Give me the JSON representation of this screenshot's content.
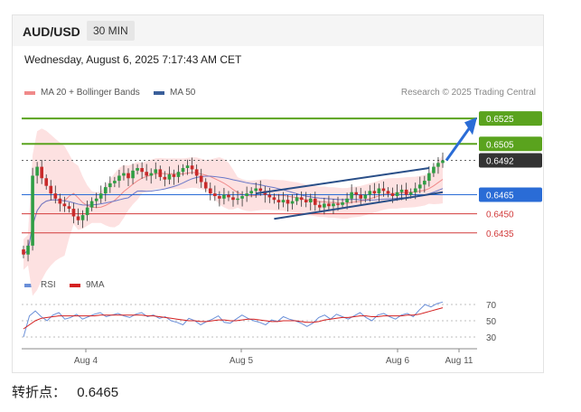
{
  "header": {
    "pair": "AUD/USD",
    "timeframe": "30 MIN"
  },
  "date": "Wednesday, August 6, 2025 7:17:43 AM CET",
  "legend": [
    {
      "label": "MA 20 + Bollinger Bands",
      "color": "#f08a8a"
    },
    {
      "label": "MA 50",
      "color": "#3a5f9a"
    }
  ],
  "credit": "Research © 2025 Trading Central",
  "rsi_legend": [
    {
      "label": "RSI",
      "color": "#6a8fd8"
    },
    {
      "label": "9MA",
      "color": "#d42020"
    }
  ],
  "footer": {
    "label": "转折点：",
    "value": "0.6465"
  },
  "chart_data": {
    "type": "candlestick",
    "price_range": [
      0.6405,
      0.654
    ],
    "x_ticks": [
      "Aug 4",
      "Aug 5",
      "Aug 6",
      "Aug 11"
    ],
    "levels": [
      {
        "value": 0.6525,
        "label": "0.6525",
        "kind": "target",
        "color": "#5aa31e"
      },
      {
        "value": 0.6505,
        "label": "0.6505",
        "kind": "target",
        "color": "#5aa31e"
      },
      {
        "value": 0.6492,
        "label": "0.6492",
        "kind": "last",
        "color": "#333333"
      },
      {
        "value": 0.6465,
        "label": "0.6465",
        "kind": "pivot",
        "color": "#2a6cd6"
      },
      {
        "value": 0.645,
        "label": "0.6450",
        "kind": "support",
        "color": "#d23b3b"
      },
      {
        "value": 0.6435,
        "label": "0.6435",
        "kind": "support",
        "color": "#d23b3b"
      }
    ],
    "close": [
      0.6418,
      0.6425,
      0.648,
      0.6487,
      0.6478,
      0.6472,
      0.6466,
      0.6462,
      0.6458,
      0.6456,
      0.6454,
      0.6448,
      0.6445,
      0.6449,
      0.6455,
      0.646,
      0.6462,
      0.6466,
      0.6471,
      0.6474,
      0.6476,
      0.648,
      0.6482,
      0.6478,
      0.6484,
      0.6486,
      0.6483,
      0.648,
      0.6482,
      0.6485,
      0.6479,
      0.6477,
      0.6481,
      0.6479,
      0.6483,
      0.6486,
      0.6488,
      0.6485,
      0.648,
      0.6475,
      0.647,
      0.6466,
      0.6464,
      0.6462,
      0.6465,
      0.6463,
      0.6461,
      0.6462,
      0.6464,
      0.6466,
      0.6468,
      0.647,
      0.6468,
      0.6465,
      0.6463,
      0.6461,
      0.6459,
      0.6461,
      0.6458,
      0.646,
      0.6463,
      0.6461,
      0.6459,
      0.6462,
      0.6457,
      0.6455,
      0.6458,
      0.6456,
      0.6458,
      0.6457,
      0.6459,
      0.6462,
      0.6467,
      0.6465,
      0.6462,
      0.6465,
      0.6468,
      0.6466,
      0.647,
      0.6468,
      0.6466,
      0.6464,
      0.6467,
      0.6469,
      0.6465,
      0.6467,
      0.647,
      0.6473,
      0.6476,
      0.6482,
      0.6487,
      0.649,
      0.6492
    ],
    "rsi": {
      "levels": [
        70,
        50,
        30
      ],
      "rsi_values": [
        30,
        56,
        62,
        55,
        50,
        57,
        60,
        52,
        54,
        58,
        52,
        55,
        58,
        60,
        55,
        57,
        59,
        56,
        54,
        58,
        60,
        55,
        57,
        53,
        55,
        50,
        48,
        45,
        53,
        50,
        45,
        49,
        52,
        56,
        48,
        47,
        52,
        57,
        53,
        50,
        48,
        45,
        51,
        49,
        55,
        52,
        50,
        47,
        43,
        47,
        54,
        57,
        52,
        58,
        55,
        52,
        56,
        60,
        54,
        50,
        57,
        59,
        55,
        52,
        57,
        59,
        55,
        63,
        70,
        67,
        71,
        73
      ],
      "ma_values": [
        40,
        45,
        50,
        53,
        54,
        55,
        56,
        56,
        56,
        56,
        56,
        56,
        56,
        57,
        57,
        57,
        57,
        57,
        57,
        57,
        57,
        56,
        56,
        55,
        54,
        53,
        52,
        51,
        50,
        50,
        49,
        49,
        50,
        51,
        51,
        50,
        50,
        51,
        52,
        52,
        51,
        50,
        49,
        49,
        50,
        50,
        50,
        49,
        48,
        48,
        49,
        51,
        52,
        53,
        54,
        54,
        55,
        56,
        56,
        55,
        55,
        56,
        56,
        56,
        56,
        57,
        57,
        58,
        60,
        62,
        64,
        66
      ]
    }
  }
}
